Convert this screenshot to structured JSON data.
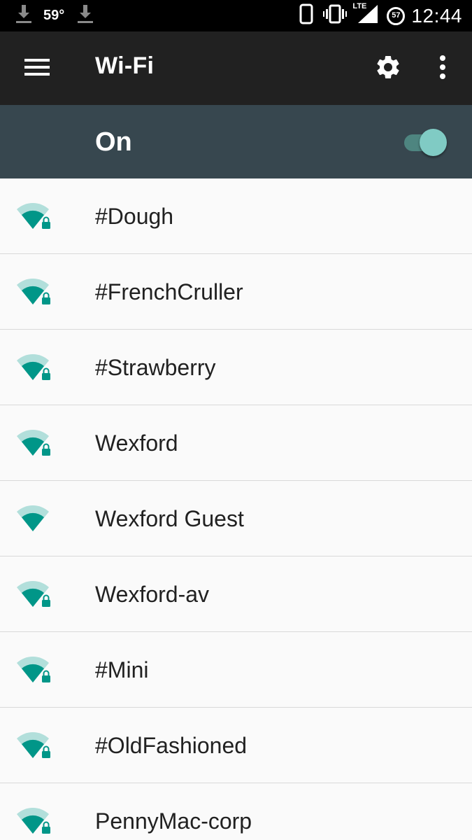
{
  "status_bar": {
    "temperature": "59°",
    "network": "LTE",
    "battery": "57",
    "clock": "12:44"
  },
  "toolbar": {
    "title": "Wi-Fi"
  },
  "wifi_toggle": {
    "label": "On",
    "enabled": true
  },
  "colors": {
    "accent": "#009688",
    "toolbar_bg": "#212121",
    "onbar_bg": "#37474f"
  },
  "networks": [
    {
      "ssid": "#Dough",
      "secured": true
    },
    {
      "ssid": "#FrenchCruller",
      "secured": true
    },
    {
      "ssid": "#Strawberry",
      "secured": true
    },
    {
      "ssid": "Wexford",
      "secured": true
    },
    {
      "ssid": "Wexford Guest",
      "secured": false
    },
    {
      "ssid": "Wexford-av",
      "secured": true
    },
    {
      "ssid": "#Mini",
      "secured": true
    },
    {
      "ssid": "#OldFashioned",
      "secured": true
    },
    {
      "ssid": "PennyMac-corp",
      "secured": true
    }
  ]
}
